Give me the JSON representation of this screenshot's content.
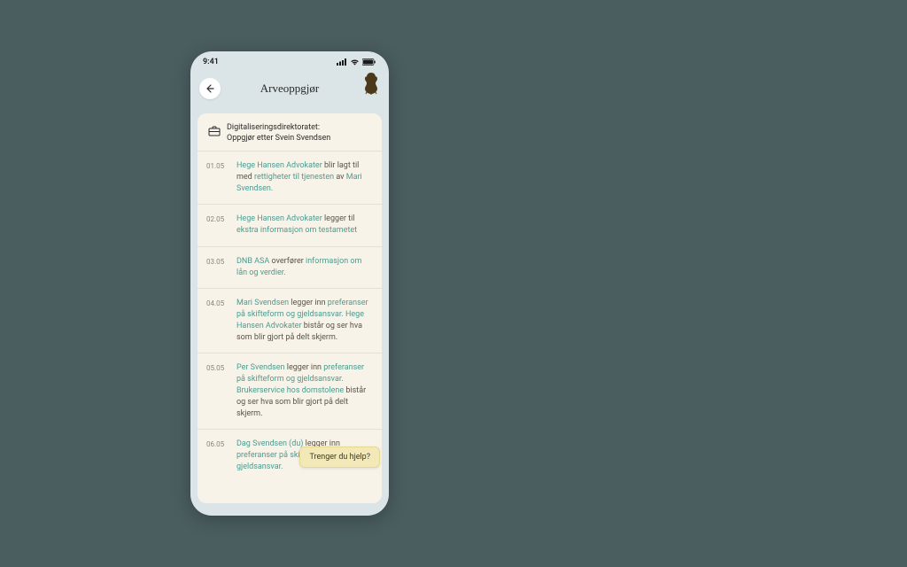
{
  "status": {
    "time": "9:41"
  },
  "header": {
    "title": "Arveoppgjør"
  },
  "card": {
    "header_line1": "Digitaliseringsdirektoratet:",
    "header_line2": "Oppgjør etter Svein Svendsen"
  },
  "feed": [
    {
      "date": "01.05",
      "parts": [
        {
          "t": "Hege Hansen Advokater",
          "link": true
        },
        {
          "t": " blir lagt til med "
        },
        {
          "t": "rettigheter til tjenesten",
          "link": true
        },
        {
          "t": " av "
        },
        {
          "t": "Mari Svendsen.",
          "link": true
        }
      ]
    },
    {
      "date": "02.05",
      "parts": [
        {
          "t": "Hege Hansen Advokater",
          "link": true
        },
        {
          "t": " legger til "
        },
        {
          "t": "ekstra informasjon om testametet",
          "link": true
        }
      ]
    },
    {
      "date": "03.05",
      "parts": [
        {
          "t": "DNB ASA",
          "link": true
        },
        {
          "t": " overfører "
        },
        {
          "t": "informasjon om lån og verdier.",
          "link": true
        }
      ]
    },
    {
      "date": "04.05",
      "parts": [
        {
          "t": "Mari Svendsen",
          "link": true
        },
        {
          "t": " legger inn "
        },
        {
          "t": "preferanser på skifteform og gjeldsansvar.",
          "link": true
        },
        {
          "t": " "
        },
        {
          "t": "Hege Hansen Advokater",
          "link": true
        },
        {
          "t": " bistår og ser hva som blir gjort på delt skjerm."
        }
      ]
    },
    {
      "date": "05.05",
      "parts": [
        {
          "t": "Per Svendsen",
          "link": true
        },
        {
          "t": " legger inn "
        },
        {
          "t": "preferanser på skifteform og gjeldsansvar.",
          "link": true
        },
        {
          "t": " "
        },
        {
          "t": "Brukerservice hos domstolene",
          "link": true
        },
        {
          "t": " bistår og ser hva som blir gjort på delt skjerm."
        }
      ]
    },
    {
      "date": "06.05",
      "parts": [
        {
          "t": "Dag Svendsen (du)",
          "link": true
        },
        {
          "t": " legger inn "
        },
        {
          "t": "preferanser på skifteform og gjeldsansvar.",
          "link": true
        }
      ]
    }
  ],
  "help": {
    "label": "Trenger du hjelp?"
  },
  "colors": {
    "background": "#4a5d5f",
    "phone_bg": "#dbe5e7",
    "card_bg": "#f7f3e9",
    "link": "#4d9b8f",
    "text": "#5a5348",
    "date": "#8a8478",
    "help_bg": "#f3e9b8"
  }
}
